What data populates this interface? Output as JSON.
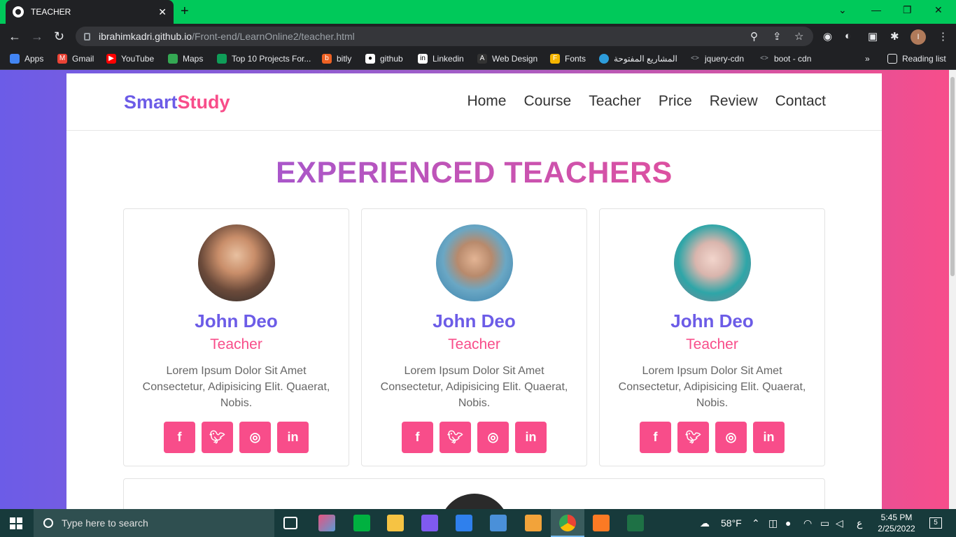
{
  "browser": {
    "tab_title": "TEACHER",
    "url_host": "ibrahimkadri.github.io",
    "url_path": "/Front-end/LearnOnline2/teacher.html",
    "bookmarks": [
      {
        "label": "Apps",
        "icon": "apps-grid-icon",
        "color": "#4285f4"
      },
      {
        "label": "Gmail",
        "icon": "gmail-icon",
        "color": "#ea4335"
      },
      {
        "label": "YouTube",
        "icon": "youtube-icon",
        "color": "#ff0000"
      },
      {
        "label": "Maps",
        "icon": "maps-icon",
        "color": "#34a853"
      },
      {
        "label": "Top 10 Projects For...",
        "icon": "link-icon",
        "color": "#0f9d58"
      },
      {
        "label": "bitly",
        "icon": "bitly-icon",
        "color": "#ee6123"
      },
      {
        "label": "github",
        "icon": "github-icon",
        "color": "#ffffff"
      },
      {
        "label": "Linkedin",
        "icon": "linkedin-icon",
        "color": "#ffffff"
      },
      {
        "label": "Web Design",
        "icon": "web-design-icon",
        "color": "#333333"
      },
      {
        "label": "Fonts",
        "icon": "fonts-icon",
        "color": "#f4b400"
      },
      {
        "label": "المشاريع المفتوحة",
        "icon": "circle-icon",
        "color": "#2d9cdb"
      },
      {
        "label": "jquery-cdn",
        "icon": "code-icon",
        "color": "#9aa0a6"
      },
      {
        "label": "boot - cdn",
        "icon": "code-icon",
        "color": "#9aa0a6"
      }
    ],
    "more": "»",
    "reading_list": "Reading list"
  },
  "site": {
    "logo_part1": "Smart",
    "logo_part2": "Study",
    "nav": [
      "Home",
      "Course",
      "Teacher",
      "Price",
      "Review",
      "Contact"
    ],
    "section_title": "EXPERIENCED TEACHERS",
    "teachers": [
      {
        "name": "John Deo",
        "role": "Teacher",
        "desc": "Lorem Ipsum Dolor Sit Amet Consectetur, Adipisicing Elit. Quaerat, Nobis."
      },
      {
        "name": "John Deo",
        "role": "Teacher",
        "desc": "Lorem Ipsum Dolor Sit Amet Consectetur, Adipisicing Elit. Quaerat, Nobis."
      },
      {
        "name": "John Deo",
        "role": "Teacher",
        "desc": "Lorem Ipsum Dolor Sit Amet Consectetur, Adipisicing Elit. Quaerat, Nobis."
      }
    ],
    "social_icons": [
      "facebook-icon",
      "twitter-icon",
      "instagram-icon",
      "linkedin-icon"
    ],
    "colors": {
      "primary": "#6c5ce7",
      "accent": "#f84d8a"
    }
  },
  "taskbar": {
    "search_placeholder": "Type here to search",
    "weather": "58°F",
    "time": "5:45 PM",
    "date": "2/25/2022",
    "notifications": "5",
    "lang": "ع"
  }
}
